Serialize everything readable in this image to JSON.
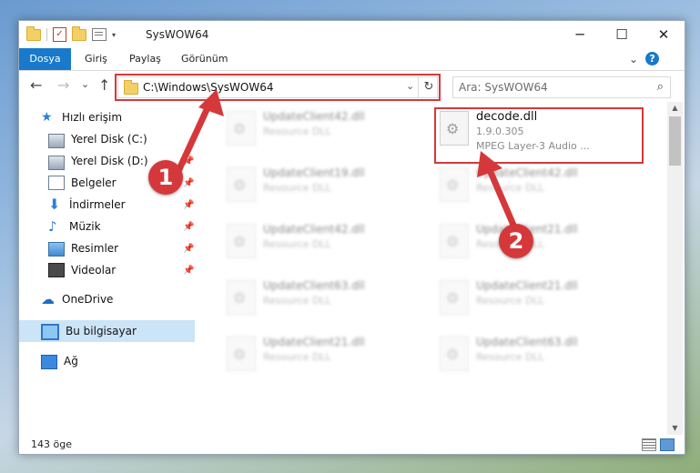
{
  "window": {
    "title": "SysWOW64",
    "controls": {
      "minimize": "─",
      "maximize": "☐",
      "close": "✕"
    }
  },
  "qat": {
    "dropdown": "▾"
  },
  "ribbon": {
    "tabs": [
      {
        "label": "Dosya"
      },
      {
        "label": "Giriş"
      },
      {
        "label": "Paylaş"
      },
      {
        "label": "Görünüm"
      }
    ],
    "chevron": "⌄",
    "help": "?"
  },
  "nav": {
    "back": "←",
    "forward": "→",
    "recent": "⌄",
    "up": "↑",
    "address": "C:\\Windows\\SysWOW64",
    "address_dropdown": "⌄",
    "refresh": "↻",
    "search_placeholder": "Ara: SysWOW64",
    "search_icon": "⌕"
  },
  "sidebar": {
    "items": [
      {
        "label": "Hızlı erişim",
        "icon": "star-icon"
      },
      {
        "label": "Yerel Disk (C:)",
        "icon": "drive-icon"
      },
      {
        "label": "Yerel Disk (D:)",
        "icon": "drive-icon"
      },
      {
        "label": "Belgeler",
        "icon": "documents-icon"
      },
      {
        "label": "İndirmeler",
        "icon": "downloads-icon"
      },
      {
        "label": "Müzik",
        "icon": "music-icon"
      },
      {
        "label": "Resimler",
        "icon": "pictures-icon"
      },
      {
        "label": "Videolar",
        "icon": "videos-icon"
      },
      {
        "label": "OneDrive",
        "icon": "cloud-icon"
      },
      {
        "label": "Bu bilgisayar",
        "icon": "computer-icon"
      },
      {
        "label": "Ağ",
        "icon": "network-icon"
      }
    ],
    "pin_glyph": "📌"
  },
  "files": [
    {
      "name": "UpdateClient42.dll",
      "type": "Resource DLL"
    },
    {
      "name": "decode.dll",
      "version": "1.9.0.305",
      "type": "MPEG Layer-3 Audio ..."
    },
    {
      "name": "UpdateClient19.dll",
      "type": "Resource DLL"
    },
    {
      "name": "UpdateClient42.dll",
      "type": "Resource DLL"
    },
    {
      "name": "UpdateClient42.dll",
      "type": "Resource DLL"
    },
    {
      "name": "UpdateClient21.dll",
      "type": "Resource DLL"
    },
    {
      "name": "UpdateClient63.dll",
      "type": "Resource DLL"
    },
    {
      "name": "UpdateClient21.dll",
      "type": "Resource DLL"
    },
    {
      "name": "UpdateClient21.dll",
      "type": "Resource DLL"
    },
    {
      "name": "UpdateClient63.dll",
      "type": "Resource DLL"
    }
  ],
  "scroll": {
    "up": "▲",
    "down": "▼"
  },
  "status": {
    "count": "143 öge"
  },
  "annotations": {
    "marker1": "1",
    "marker2": "2"
  },
  "colors": {
    "accent": "#1979ca",
    "highlight": "#d5383b",
    "selection": "#cce4f7"
  }
}
